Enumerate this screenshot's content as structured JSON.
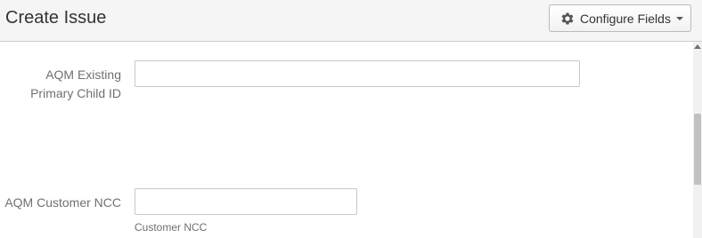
{
  "dialog": {
    "title": "Create Issue",
    "configure_fields_label": "Configure Fields"
  },
  "icons": {
    "configure": "gear-icon",
    "dropdown": "caret-down-icon"
  },
  "fields": [
    {
      "label": "AQM Existing Primary Child ID",
      "value": "",
      "help": ""
    },
    {
      "label": "AQM Customer NCC",
      "value": "",
      "help": "Customer NCC"
    }
  ]
}
